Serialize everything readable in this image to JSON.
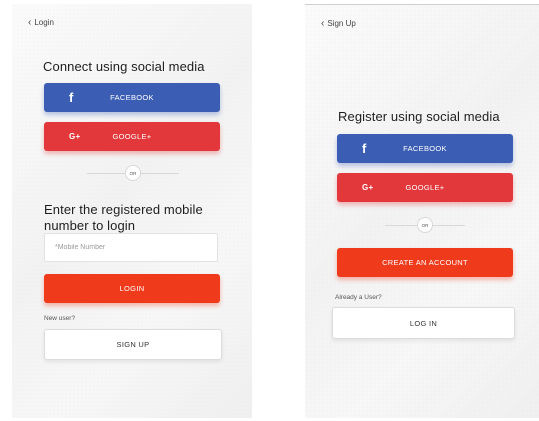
{
  "login": {
    "back_label": "Login",
    "social_heading": "Connect using social media",
    "facebook_label": "FACEBOOK",
    "google_label": "GOOGLE+",
    "or_label": "OR",
    "mobile_heading": "Enter the registered mobile number to login",
    "mobile_placeholder": "*Mobile Number",
    "login_button": "LOGIN",
    "new_user_text": "New user?",
    "signup_button": "SIGN UP"
  },
  "signup": {
    "back_label": "Sign Up",
    "social_heading": "Register using social media",
    "facebook_label": "FACEBOOK",
    "google_label": "GOOGLE+",
    "or_label": "OR",
    "create_button": "CREATE AN ACCOUNT",
    "already_user_text": "Already a User?",
    "login_button": "LOG IN"
  },
  "icons": {
    "back": "chevron-left-icon",
    "facebook": "facebook-icon",
    "google": "google-plus-icon"
  },
  "colors": {
    "facebook": "#3b5eb4",
    "google": "#e2383b",
    "primary": "#f03a1c"
  }
}
